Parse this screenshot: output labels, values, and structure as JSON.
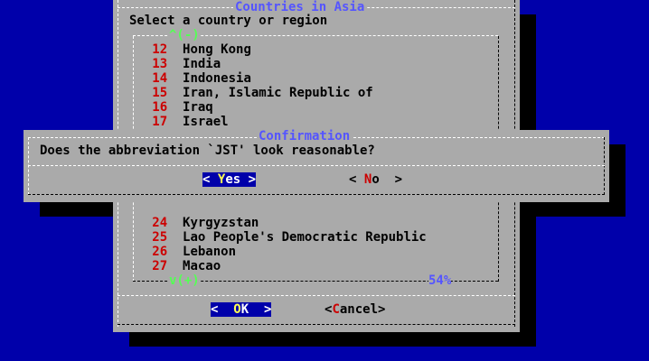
{
  "back_dialog": {
    "title": "Countries in Asia",
    "prompt": "Select a country or region",
    "scroll_up": "^(-)",
    "scroll_down": "v(+)",
    "percent": "54%",
    "items_top": [
      {
        "num": "12",
        "label": "Hong Kong"
      },
      {
        "num": "13",
        "label": "India"
      },
      {
        "num": "14",
        "label": "Indonesia"
      },
      {
        "num": "15",
        "label": "Iran, Islamic Republic of"
      },
      {
        "num": "16",
        "label": "Iraq"
      },
      {
        "num": "17",
        "label": "Israel"
      }
    ],
    "items_bottom": [
      {
        "num": "24",
        "label": "Kyrgyzstan"
      },
      {
        "num": "25",
        "label": "Lao People's Democratic Republic"
      },
      {
        "num": "26",
        "label": "Lebanon"
      },
      {
        "num": "27",
        "label": "Macao"
      }
    ],
    "ok": {
      "left": "<",
      "hot": "O",
      "rest": "K",
      "right": ">"
    },
    "cancel": {
      "left": "<",
      "hot": "C",
      "rest": "ancel",
      "right": ">"
    }
  },
  "confirm_dialog": {
    "title": "Confirmation",
    "message": "Does the abbreviation `JST' look reasonable?",
    "yes": {
      "left": "<",
      "hot": "Y",
      "rest": "es",
      "right": ">"
    },
    "no": {
      "left": "<",
      "hot": "N",
      "rest": "o",
      "right": ">"
    }
  },
  "colors": {
    "background": "#0000aa",
    "dialog": "#aaaaaa",
    "hotkey": "#cc0000",
    "title": "#5555ff",
    "scroll_indicator": "#55ff55"
  }
}
